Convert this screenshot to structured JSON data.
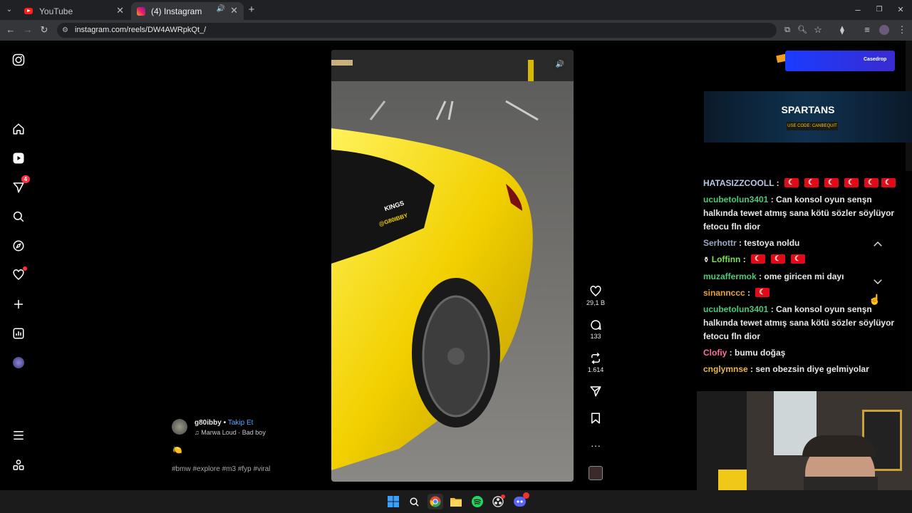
{
  "browser": {
    "tabs": [
      {
        "title": "YouTube",
        "active": false
      },
      {
        "title": "(4) Instagram",
        "active": true
      }
    ],
    "url": "instagram.com/reels/DW4AWRpkQt_/"
  },
  "sidebar": {
    "notification_count": "4"
  },
  "post": {
    "username": "g80ibby",
    "separator": "•",
    "follow_label": "Takip Et",
    "audio": "Marwa Loud · Bad boy",
    "caption_emoji": "🍋",
    "hashtags": "#bmw #explore #m3 #fyp #viral",
    "video_sticker": "KINGS",
    "video_handle": "@G80IBBY"
  },
  "actions": {
    "likes": "29,1 B",
    "comments": "133",
    "reposts": "1.614"
  },
  "stream_overlay": {
    "banner_brand": "Casedrop",
    "sponsor_name": "SPARTANS",
    "sponsor_code": "USE CODE: CANBEQUIT"
  },
  "chat": [
    {
      "user": "HATASIZZCOOLL",
      "color": "#b8c7e8",
      "text": "",
      "flags": 6
    },
    {
      "user": "ucubetolun3401",
      "color": "#4ec97a",
      "text": "Can konsol oyun senşn halkında tewet atmış sana kötü sözler söylüyor fetocu fln dior",
      "flags": 0
    },
    {
      "user": "Serhottr",
      "color": "#9ea8c8",
      "text": "testoya noldu",
      "flags": 0
    },
    {
      "user": "Loffinn",
      "color": "#7ee05a",
      "text": "",
      "flags": 3,
      "icon": "⚱"
    },
    {
      "user": "muzaffermok",
      "color": "#4ec97a",
      "text": "ome giricen mi dayı",
      "flags": 0
    },
    {
      "user": "sinannccc",
      "color": "#e8a23a",
      "text": "",
      "flags": 1
    },
    {
      "user": "ucubetolun3401",
      "color": "#4ec97a",
      "text": "Can konsol oyun senşn halkında tewet atmış sana kötü sözler söylüyor fetocu fln dior",
      "flags": 0
    },
    {
      "user": "Clofiy",
      "color": "#ff6ea0",
      "text": "bumu doğaş",
      "flags": 0
    },
    {
      "user": "cnglymnse",
      "color": "#e8b84a",
      "text": "sen obezsin diye gelmiyolar",
      "flags": 0
    }
  ],
  "colors": {
    "accent_blue": "#4ea8ff",
    "video_yellow": "#f5d300"
  }
}
